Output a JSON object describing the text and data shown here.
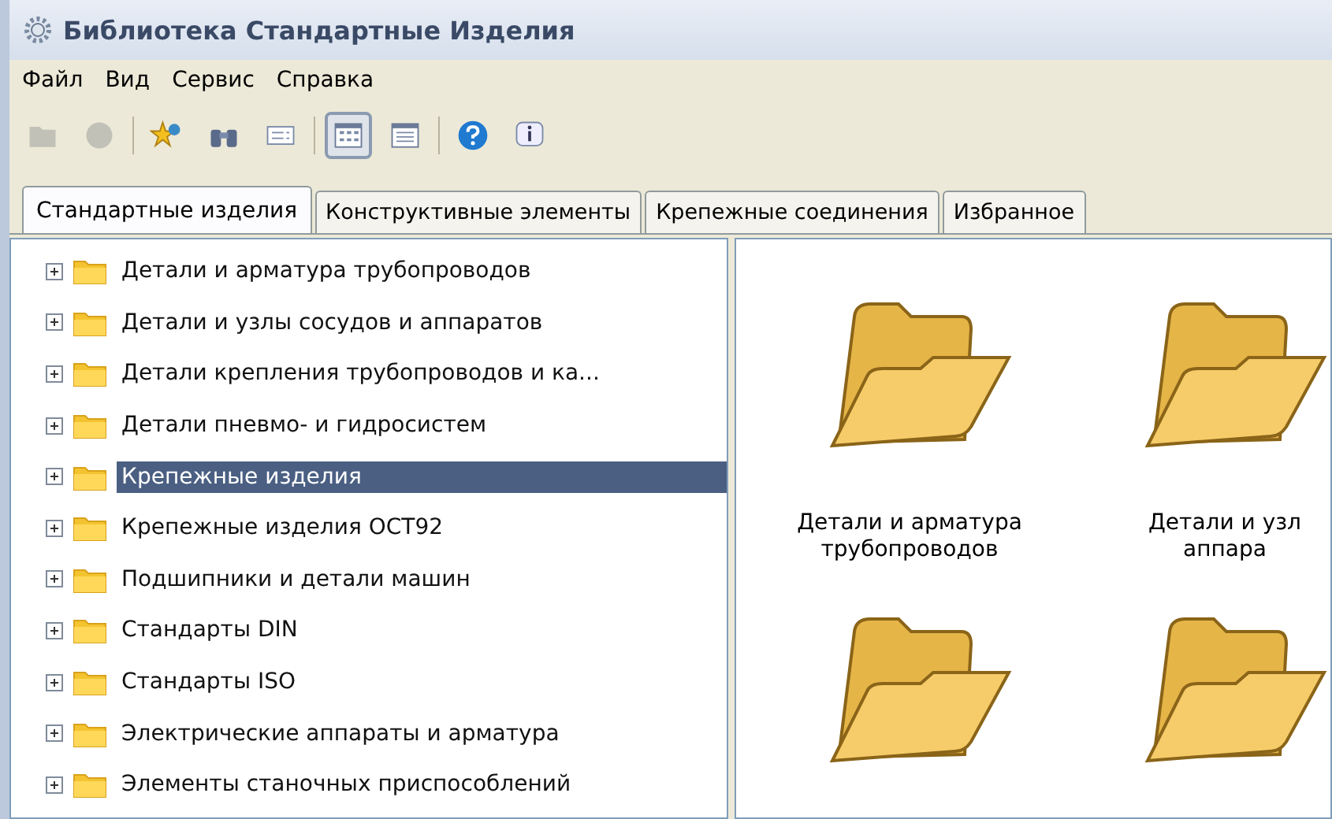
{
  "window": {
    "title": "Библиотека Стандартные Изделия"
  },
  "menu": [
    "Файл",
    "Вид",
    "Сервис",
    "Справка"
  ],
  "toolbar": [
    {
      "kind": "folder",
      "disabled": true,
      "selected": false
    },
    {
      "kind": "circle",
      "disabled": true,
      "selected": false
    },
    {
      "kind": "separator"
    },
    {
      "kind": "star",
      "disabled": false,
      "selected": false
    },
    {
      "kind": "binoculars",
      "disabled": false,
      "selected": false
    },
    {
      "kind": "card",
      "disabled": false,
      "selected": false
    },
    {
      "kind": "separator"
    },
    {
      "kind": "icons-view",
      "disabled": false,
      "selected": true
    },
    {
      "kind": "list-view",
      "disabled": false,
      "selected": false
    },
    {
      "kind": "separator"
    },
    {
      "kind": "help",
      "disabled": false,
      "selected": false
    },
    {
      "kind": "info",
      "disabled": false,
      "selected": false
    }
  ],
  "tabs": [
    {
      "label": "Стандартные изделия",
      "selected": true
    },
    {
      "label": "Конструктивные элементы",
      "selected": false
    },
    {
      "label": "Крепежные соединения",
      "selected": false
    },
    {
      "label": "Избранное",
      "selected": false
    }
  ],
  "tree": [
    {
      "label": "Детали и арматура трубопроводов",
      "expanded": false,
      "selected": false
    },
    {
      "label": "Детали и узлы сосудов и аппаратов",
      "expanded": false,
      "selected": false
    },
    {
      "label": "Детали крепления трубопроводов и ка...",
      "expanded": false,
      "selected": false
    },
    {
      "label": "Детали пневмо- и гидросистем",
      "expanded": false,
      "selected": false
    },
    {
      "label": "Крепежные изделия",
      "expanded": false,
      "selected": true
    },
    {
      "label": "Крепежные изделия ОСТ92",
      "expanded": false,
      "selected": false
    },
    {
      "label": "Подшипники и детали машин",
      "expanded": false,
      "selected": false
    },
    {
      "label": "Стандарты DIN",
      "expanded": false,
      "selected": false
    },
    {
      "label": "Стандарты ISO",
      "expanded": false,
      "selected": false
    },
    {
      "label": "Электрические аппараты и арматура",
      "expanded": false,
      "selected": false
    },
    {
      "label": "Элементы станочных приспособлений",
      "expanded": false,
      "selected": false
    }
  ],
  "folders": [
    {
      "kind": "folder",
      "label_lines": [
        "Детали и арматура",
        "трубопроводов"
      ]
    },
    {
      "kind": "folder",
      "label_lines": [
        "Детали и узл",
        "аппара"
      ]
    },
    {
      "kind": "folder"
    },
    {
      "kind": "folder"
    }
  ]
}
